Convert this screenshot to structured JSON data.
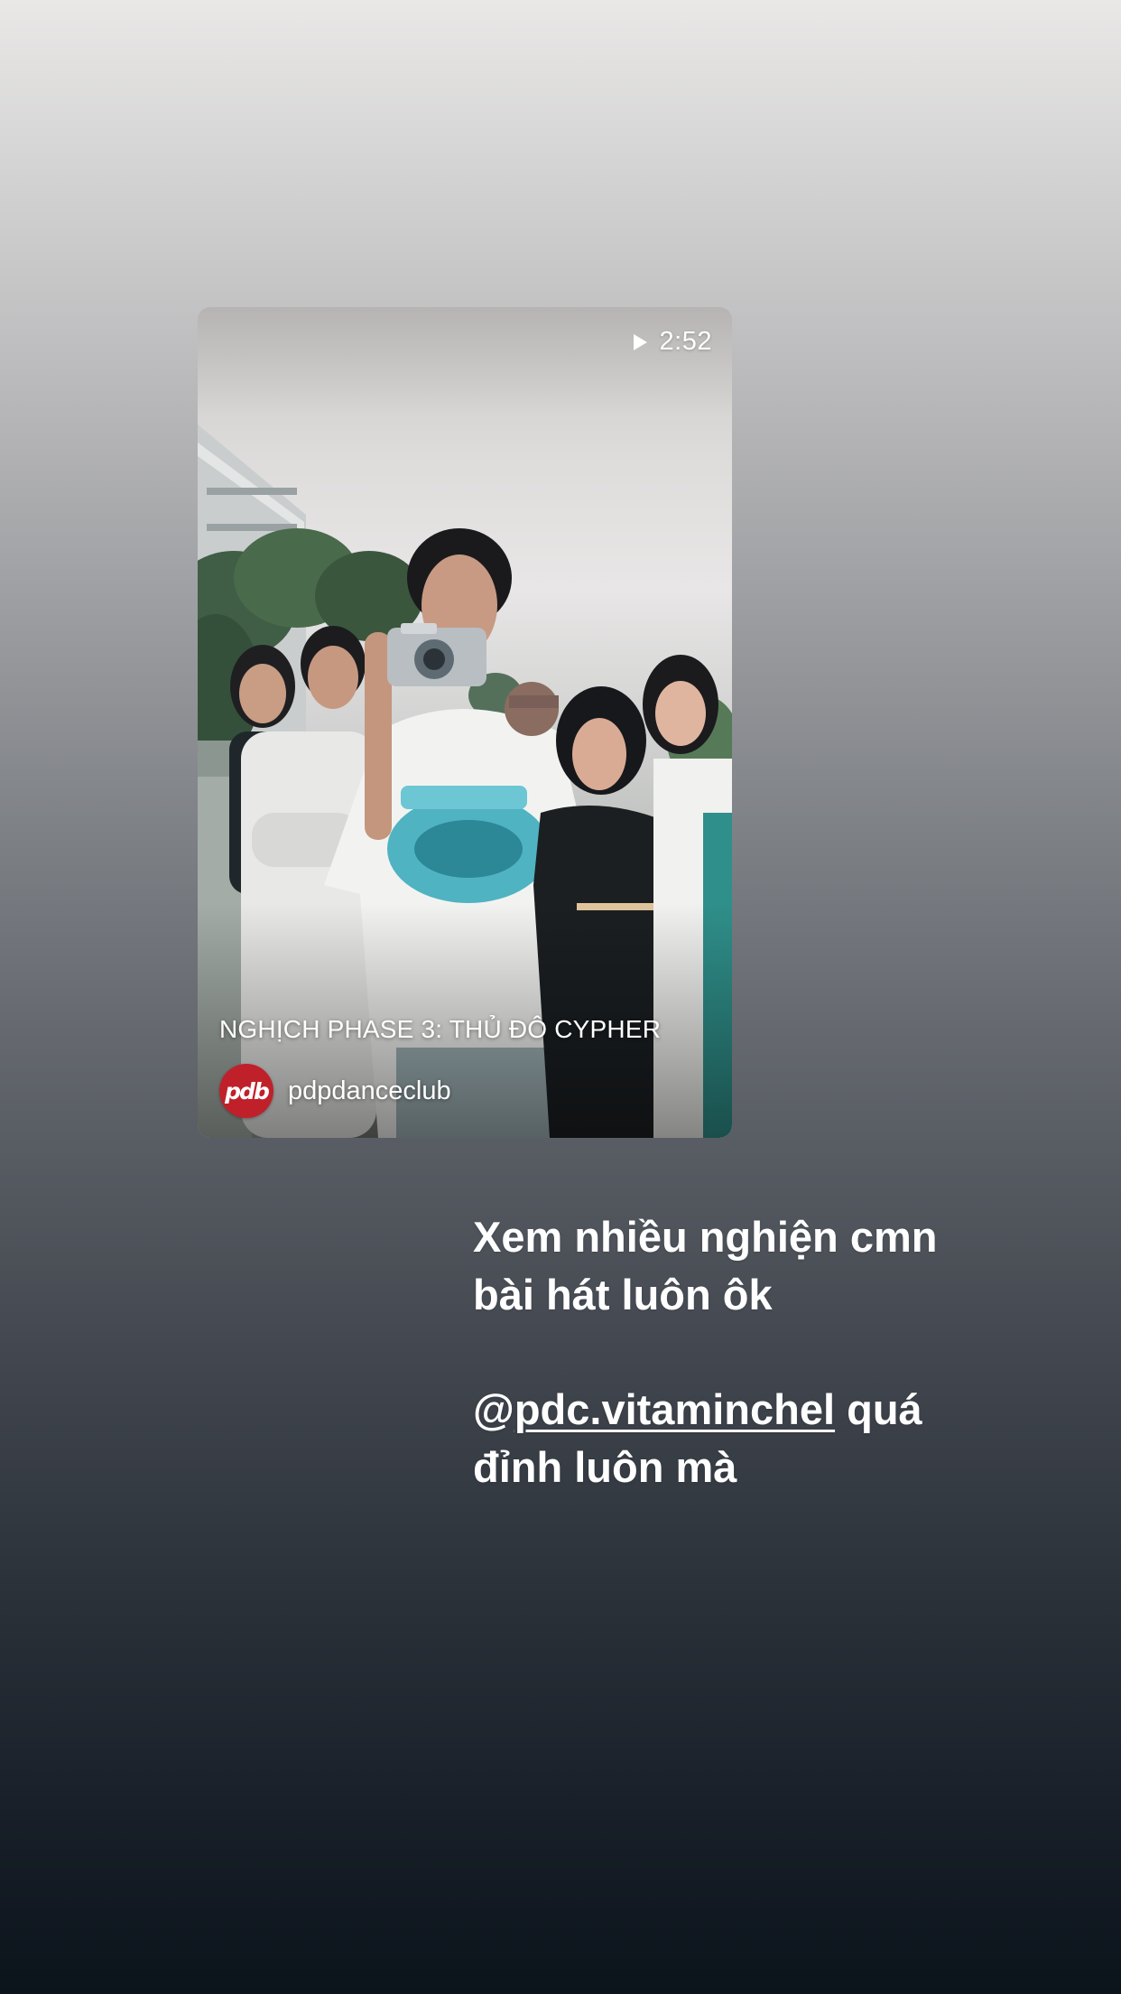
{
  "story": {
    "video_card": {
      "duration": "2:52",
      "title": "NGHỊCH PHASE 3: THỦ ĐÔ CYPHER",
      "channel": {
        "name": "pdpdanceclub",
        "avatar_text": "pdb",
        "avatar_color": "#c0202a"
      },
      "icons": {
        "play": "play-icon"
      }
    },
    "caption": {
      "line1": "Xem nhiều nghiện cmn",
      "line2": "bài hát luôn ôk",
      "mention_prefix": "@",
      "mention_handle": "pdc.vitaminchel",
      "after_mention": " quá",
      "line4": "đỉnh luôn mà"
    }
  },
  "colors": {
    "background_top": "#e9e8e7",
    "background_bottom": "#0b131b",
    "text": "#ffffff"
  }
}
